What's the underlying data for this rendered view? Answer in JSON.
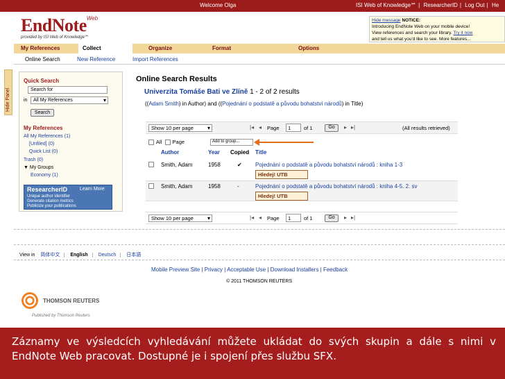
{
  "topbar": {
    "welcome": "Welcome Olga",
    "links": [
      "ISI Web of Knowledge℠",
      "ResearcherID",
      "Log Out",
      "He"
    ]
  },
  "logo": {
    "name": "EndNote",
    "superscript": "Web",
    "tagline": "provided by ISI Web of Knowledge℠"
  },
  "notice": {
    "hide": "Hide message",
    "label": "NOTICE:",
    "line1": "Introducing EndNote Web on your mobile device!",
    "line2": "View references and search your library.",
    "try": "Try it now",
    "line3": "and tell us what you'd like to see. More features..."
  },
  "nav": {
    "tabs": [
      "My References",
      "Collect",
      "Organize",
      "Format",
      "Options"
    ],
    "active": "Collect",
    "subtabs": [
      "Online Search",
      "New Reference",
      "Import References"
    ]
  },
  "hide_panel": "Hide Panel",
  "left_panel": {
    "quick_search_title": "Quick Search",
    "search_placeholder": "Search for",
    "in_label": "in",
    "in_value": "All My References",
    "search_button": "Search",
    "my_refs_title": "My References",
    "items": [
      "All My References (1)",
      "[Unfiled] (0)",
      "Quick List (0)",
      "Trash (0)",
      "▼ My Groups",
      "Economy (1)"
    ],
    "researcherid": {
      "title": "ResearcherID",
      "learn_more": "Learn More",
      "bullets": [
        "Unique author identifier",
        "Generate citation metrics",
        "Publicize your publications"
      ]
    }
  },
  "results": {
    "title": "Online Search Results",
    "database": "Univerzita Tomáše Bati ve Zlíně",
    "count": "1 - 2 of 2 results",
    "query_open": "((",
    "query_author": "Adam Smith",
    "query_in1": ") in Author) and ((",
    "query_title": "Pojednání o podstatě a původu bohatství národů",
    "query_in2": ") in Title)",
    "pager": {
      "show_label": "Show 10 per page",
      "page_label": "Page",
      "page_value": "1",
      "of_label": "of 1",
      "go_label": "Go",
      "all_label": "(All results retrieved)"
    },
    "select": {
      "all": "All",
      "page": "Page",
      "add_to_group": "Add to group..."
    },
    "columns": {
      "author": "Author",
      "year": "Year",
      "copied": "Copied",
      "title": "Title"
    },
    "records": [
      {
        "author": "Smith, Adam",
        "year": "1958",
        "copied": "✔",
        "title": "Pojednání o podstatě a původu bohatství národů : kniha 1-3",
        "link": "Hledej! UTB"
      },
      {
        "author": "Smith, Adam",
        "year": "1958",
        "copied": "-",
        "title": "Pojednání o podstatě a původu bohatství národů : kniha 4-5. 2. sv",
        "link": "Hledej! UTB"
      }
    ]
  },
  "footer": {
    "view_in": "View in",
    "languages": [
      "简体中文",
      "English",
      "Deutsch",
      "日本語"
    ],
    "links": "Mobile Preview Site | Privacy | Acceptable Use | Download Installers | Feedback",
    "copyright": "© 2011 THOMSON REUTERS",
    "tr_name": "THOMSON REUTERS",
    "tr_published": "Published by Thomson Reuters"
  },
  "caption": "Záznamy ve výsledcích vyhledávání můžete ukládat do svých skupin a dále s nimi v EndNote Web pracovat. Dostupné je i spojení přes službu SFX.",
  "colors": {
    "brand": "#9c1c1c",
    "nav": "#f2d79a",
    "link": "#1a3fa0",
    "arrow": "#e46c1a"
  }
}
